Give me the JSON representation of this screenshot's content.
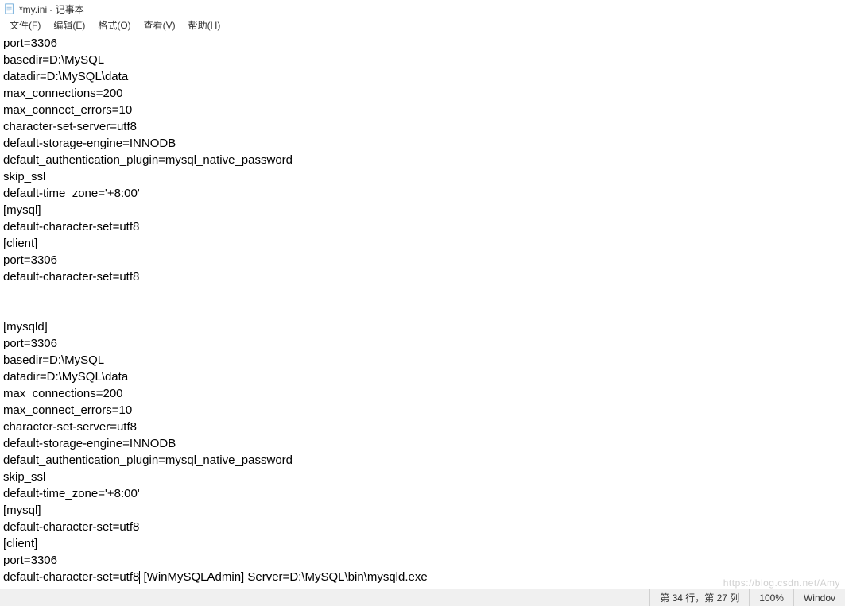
{
  "window": {
    "title": "*my.ini - 记事本"
  },
  "menu": {
    "file": "文件(F)",
    "edit": "编辑(E)",
    "format": "格式(O)",
    "view": "查看(V)",
    "help": "帮助(H)"
  },
  "content": {
    "lines": [
      "port=3306",
      "basedir=D:\\MySQL",
      "datadir=D:\\MySQL\\data",
      "max_connections=200",
      "max_connect_errors=10",
      "character-set-server=utf8",
      "default-storage-engine=INNODB",
      "default_authentication_plugin=mysql_native_password",
      "skip_ssl",
      "default-time_zone='+8:00'",
      "[mysql]",
      "default-character-set=utf8",
      "[client]",
      "port=3306",
      "default-character-set=utf8",
      "",
      "",
      "[mysqld]",
      "port=3306",
      "basedir=D:\\MySQL",
      "datadir=D:\\MySQL\\data",
      "max_connections=200",
      "max_connect_errors=10",
      "character-set-server=utf8",
      "default-storage-engine=INNODB",
      "default_authentication_plugin=mysql_native_password",
      "skip_ssl",
      "default-time_zone='+8:00'",
      "[mysql]",
      "default-character-set=utf8",
      "[client]",
      "port=3306"
    ],
    "last_line_part1": "default-character-set=utf8",
    "last_line_part2": " [WinMySQLAdmin] Server=D:\\MySQL\\bin\\mysqld.exe"
  },
  "status": {
    "position": "第 34 行，第 27 列",
    "zoom": "100%",
    "platform": "Windov"
  },
  "watermark": "https://blog.csdn.net/Amy"
}
